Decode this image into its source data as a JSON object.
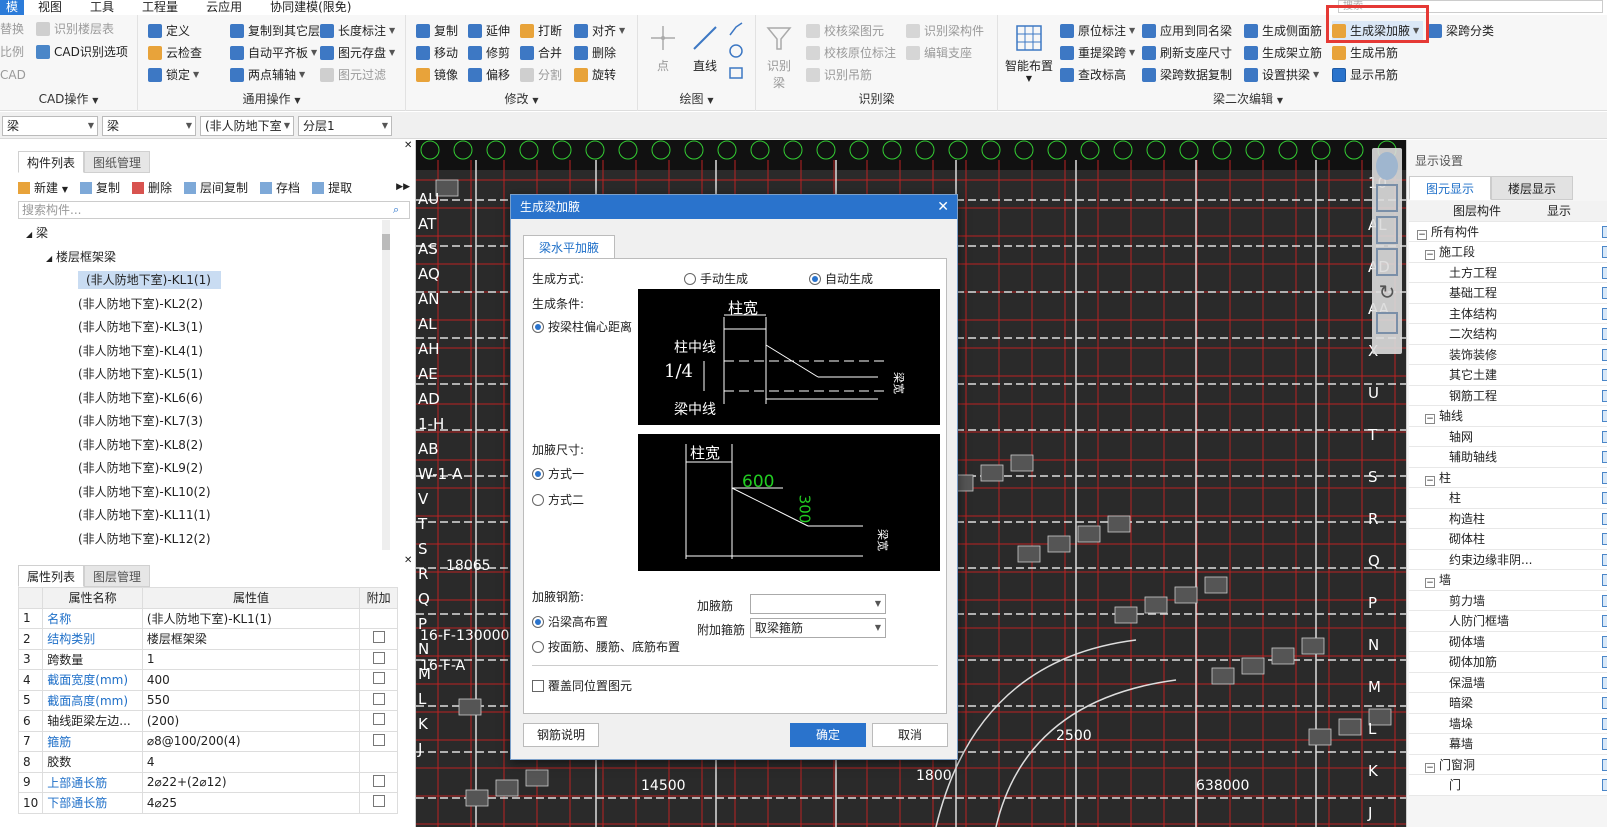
{
  "menubar": {
    "items": [
      "模",
      "视图",
      "工具",
      "工程量",
      "云应用",
      "协同建模(限免)"
    ],
    "search_placeholder": "搜索"
  },
  "ribbon": {
    "cad_group": {
      "title": "CAD操作",
      "replace": "替换",
      "recognize_floor_table": "识别楼层表",
      "scale": "比例",
      "cad_recognize_options": "CAD识别选项",
      "cad": "CAD"
    },
    "general_group": {
      "title": "通用操作",
      "define": "定义",
      "copy_to_other_floor": "复制到其它层",
      "length_dimension": "长度标注",
      "cloud_check": "云检查",
      "auto_flat_slab": "自动平齐板",
      "element_save": "图元存盘",
      "lock": "锁定",
      "two_point_axis": "两点辅轴",
      "element_filter": "图元过滤"
    },
    "modify_group": {
      "title": "修改",
      "copy": "复制",
      "extend": "延伸",
      "break": "打断",
      "align": "对齐",
      "move": "移动",
      "trim": "修剪",
      "merge": "合并",
      "delete": "删除",
      "mirror": "镜像",
      "offset": "偏移",
      "split": "分割",
      "rotate": "旋转"
    },
    "draw_group": {
      "title": "绘图",
      "point": "点",
      "line": "直线"
    },
    "recognize_group": {
      "title": "识别梁",
      "recognize_beam": "识别梁",
      "check_beam_element": "校核梁图元",
      "recognize_beam_component": "识别梁构件",
      "check_original_dim": "校核原位标注",
      "edit_support": "编辑支座",
      "recognize_hanger": "识别吊筋"
    },
    "beam_edit_group": {
      "title": "梁二次编辑",
      "smart_layout": "智能布置",
      "original_dim": "原位标注",
      "apply_same_name": "应用到同名梁",
      "gen_side_rebar": "生成侧面筋",
      "gen_haunch": "生成梁加腋",
      "span_classify": "梁跨分类",
      "re_extract_span": "重提梁跨",
      "refresh_support": "刷新支座尺寸",
      "gen_stand_rebar": "生成架立筋",
      "gen_hanger": "生成吊筋",
      "check_elevation": "查改标高",
      "copy_span_data": "梁跨数据复制",
      "set_arch": "设置拱梁",
      "show_hanger": "显示吊筋"
    }
  },
  "toolbar": {
    "combo1": "梁",
    "combo2": "梁",
    "combo3": "(非人防地下室",
    "combo4": "分层1"
  },
  "left_panel": {
    "tab_component_list": "构件列表",
    "tab_drawing_mgmt": "图纸管理",
    "new": "新建",
    "copy": "复制",
    "delete": "删除",
    "floor_copy": "层间复制",
    "save": "存档",
    "extract": "提取",
    "search_placeholder": "搜索构件...",
    "tree_root": "梁",
    "tree_group": "楼层框架梁",
    "tree_items": [
      "(非人防地下室)-KL1(1)",
      "(非人防地下室)-KL2(2)",
      "(非人防地下室)-KL3(1)",
      "(非人防地下室)-KL4(1)",
      "(非人防地下室)-KL5(1)",
      "(非人防地下室)-KL6(6)",
      "(非人防地下室)-KL7(3)",
      "(非人防地下室)-KL8(2)",
      "(非人防地下室)-KL9(2)",
      "(非人防地下室)-KL10(2)",
      "(非人防地下室)-KL11(1)",
      "(非人防地下室)-KL12(2)"
    ],
    "tab_props": "属性列表",
    "tab_layer_mgmt": "图层管理",
    "prop_headers": [
      "属性名称",
      "属性值",
      "附加"
    ],
    "props": [
      {
        "n": "1",
        "name": "名称",
        "value": "(非人防地下室)-KL1(1)",
        "blue": true,
        "cb": false
      },
      {
        "n": "2",
        "name": "结构类别",
        "value": "楼层框架梁",
        "blue": true,
        "cb": true
      },
      {
        "n": "3",
        "name": "跨数量",
        "value": "1",
        "blue": false,
        "cb": true
      },
      {
        "n": "4",
        "name": "截面宽度(mm)",
        "value": "400",
        "blue": true,
        "cb": true
      },
      {
        "n": "5",
        "name": "截面高度(mm)",
        "value": "550",
        "blue": true,
        "cb": true
      },
      {
        "n": "6",
        "name": "轴线距梁左边...",
        "value": "(200)",
        "blue": false,
        "cb": true
      },
      {
        "n": "7",
        "name": "箍筋",
        "value": "⌀8@100/200(4)",
        "blue": true,
        "cb": true
      },
      {
        "n": "8",
        "name": "胶数",
        "value": "4",
        "blue": false,
        "cb": false
      },
      {
        "n": "9",
        "name": "上部通长筋",
        "value": "2⌀22+(2⌀12)",
        "blue": true,
        "cb": true
      },
      {
        "n": "10",
        "name": "下部通长筋",
        "value": "4⌀25",
        "blue": true,
        "cb": true
      }
    ]
  },
  "right_panel": {
    "title": "显示设置",
    "tab_element_display": "图元显示",
    "tab_floor_display": "楼层显示",
    "col_layer": "图层构件",
    "col_display": "显示",
    "rows": [
      {
        "label": "所有构件",
        "level": 0,
        "exp": true
      },
      {
        "label": "施工段",
        "level": 1,
        "exp": true
      },
      {
        "label": "土方工程",
        "level": 2,
        "exp": false
      },
      {
        "label": "基础工程",
        "level": 2,
        "exp": false
      },
      {
        "label": "主体结构",
        "level": 2,
        "exp": false
      },
      {
        "label": "二次结构",
        "level": 2,
        "exp": false
      },
      {
        "label": "装饰装修",
        "level": 2,
        "exp": false
      },
      {
        "label": "其它土建",
        "level": 2,
        "exp": false
      },
      {
        "label": "钢筋工程",
        "level": 2,
        "exp": false
      },
      {
        "label": "轴线",
        "level": 1,
        "exp": true
      },
      {
        "label": "轴网",
        "level": 2,
        "exp": false
      },
      {
        "label": "辅助轴线",
        "level": 2,
        "exp": false
      },
      {
        "label": "柱",
        "level": 1,
        "exp": true
      },
      {
        "label": "柱",
        "level": 2,
        "exp": false
      },
      {
        "label": "构造柱",
        "level": 2,
        "exp": false
      },
      {
        "label": "砌体柱",
        "level": 2,
        "exp": false
      },
      {
        "label": "约束边缘非阴...",
        "level": 2,
        "exp": false
      },
      {
        "label": "墙",
        "level": 1,
        "exp": true
      },
      {
        "label": "剪力墙",
        "level": 2,
        "exp": false
      },
      {
        "label": "人防门框墙",
        "level": 2,
        "exp": false
      },
      {
        "label": "砌体墙",
        "level": 2,
        "exp": false
      },
      {
        "label": "砌体加筋",
        "level": 2,
        "exp": false
      },
      {
        "label": "保温墙",
        "level": 2,
        "exp": false
      },
      {
        "label": "暗梁",
        "level": 2,
        "exp": false
      },
      {
        "label": "墙垛",
        "level": 2,
        "exp": false
      },
      {
        "label": "幕墙",
        "level": 2,
        "exp": false
      },
      {
        "label": "门窗洞",
        "level": 1,
        "exp": true
      },
      {
        "label": "门",
        "level": 2,
        "exp": false
      }
    ]
  },
  "dialog": {
    "title": "生成梁加腋",
    "tab": "梁水平加腋",
    "gen_method_label": "生成方式:",
    "manual": "手动生成",
    "auto": "自动生成",
    "gen_condition_label": "生成条件:",
    "by_offset": "按梁柱偏心距离",
    "img1_col_width": "柱宽",
    "img1_col_center": "柱中线",
    "img1_ratio": "1/4",
    "img1_beam_center": "梁中线",
    "img1_beam": "梁宽",
    "size_label": "加腋尺寸:",
    "method1": "方式一",
    "method2": "方式二",
    "img2_col_width": "柱宽",
    "img2_600": "600",
    "img2_300": "300",
    "img2_beam": "梁宽",
    "rebar_label": "加腋钢筋:",
    "along_beam_height": "沿梁高布置",
    "by_face_rebar": "按面筋、腰筋、底筋布置",
    "haunch_rebar_label": "加腋筋",
    "haunch_rebar_value": "",
    "extra_stirrup_label": "附加箍筋",
    "extra_stirrup_value": "取梁箍筋",
    "overwrite": "覆盖同位置图元",
    "rebar_note": "钢筋说明",
    "ok": "确定",
    "cancel": "取消"
  },
  "canvas": {
    "axis_labels_left": [
      "AU",
      "AT",
      "AS",
      "AQ",
      "AN",
      "AL",
      "AH",
      "AE",
      "AD",
      "1-H",
      "AB",
      "W-1-A",
      "V",
      "T",
      "S",
      "R",
      "Q",
      "P",
      "N",
      "M",
      "L",
      "K",
      "J"
    ],
    "axis_labels_right": [
      "10",
      "AL",
      "AD",
      "AA",
      "X",
      "U",
      "T",
      "S",
      "R",
      "Q",
      "P",
      "N",
      "M",
      "L",
      "K",
      "J"
    ],
    "sample_texts": [
      "18065",
      "16-F-130000",
      "16-F-A",
      "1800",
      "2500",
      "14500",
      "638000"
    ]
  }
}
